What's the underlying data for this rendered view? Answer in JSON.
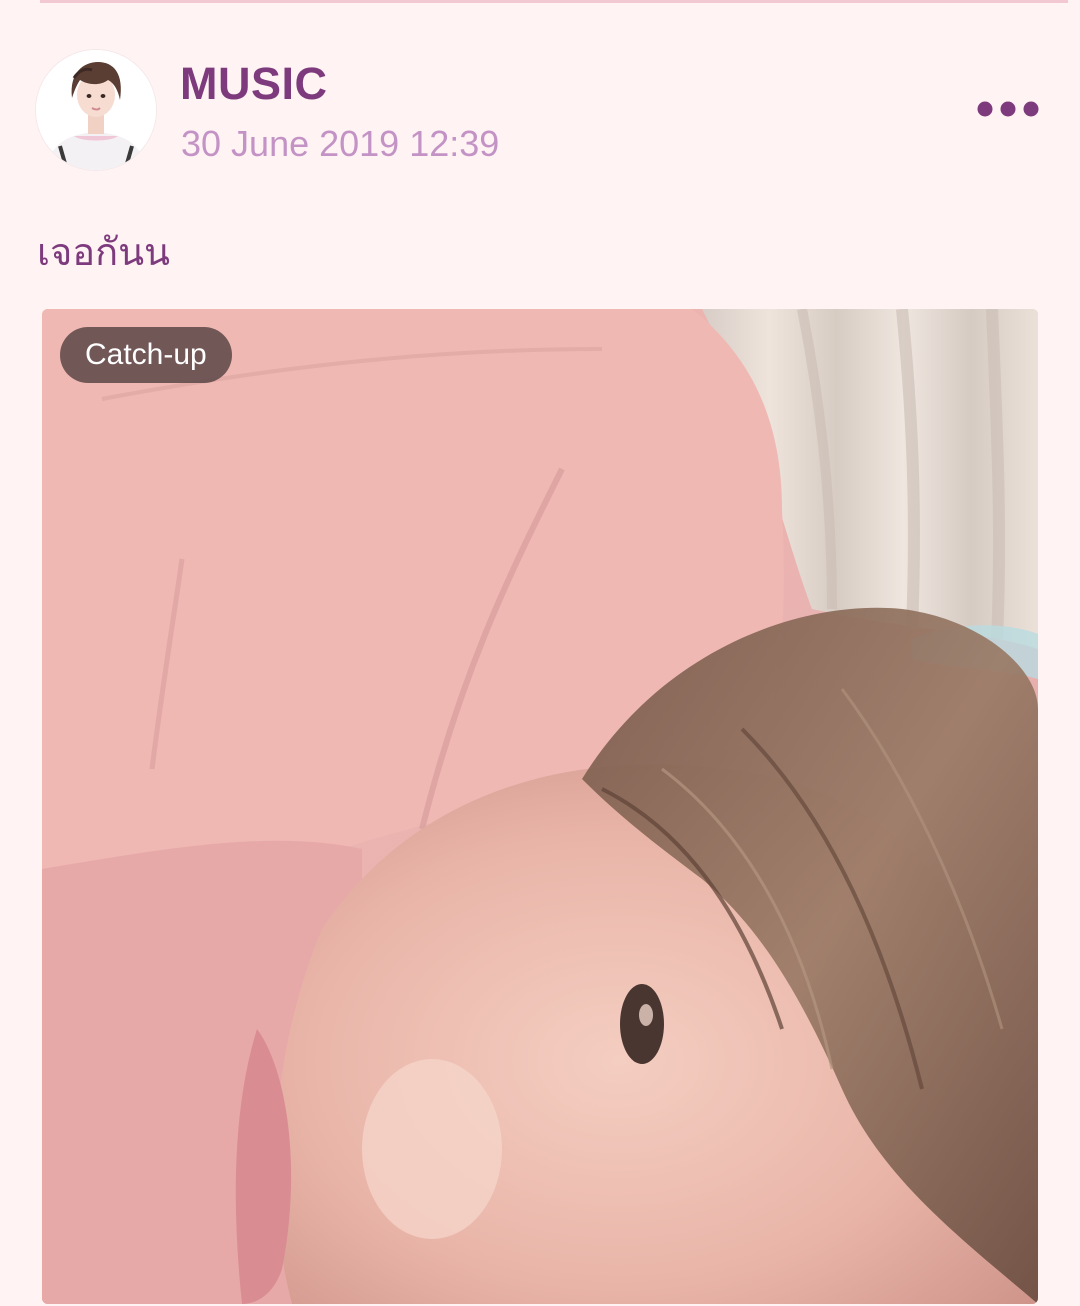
{
  "post": {
    "author": "MUSIC",
    "timestamp": "30 June 2019 12:39",
    "caption": "เจอกันน",
    "badge": "Catch-up",
    "more_icon": "more-horizontal-icon",
    "avatar_icon": "profile-photo",
    "photo_description": "selfie-photo"
  },
  "colors": {
    "background": "#fff3f3",
    "accent": "#7d3b7e",
    "muted_accent": "#c493c6",
    "badge_bg": "#4e3c3e"
  }
}
